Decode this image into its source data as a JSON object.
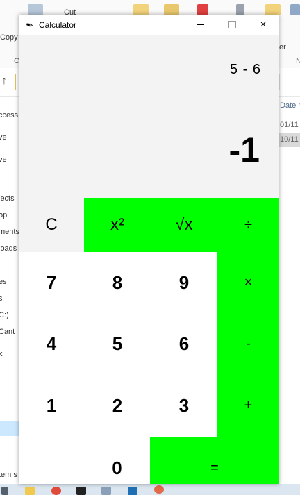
{
  "background_explorer": {
    "ribbon": {
      "copy_label": "Copy",
      "cut_label": "Cut",
      "clip_label": "C",
      "partial_label_right": "er",
      "n_label": "N"
    },
    "column_header_date": "Date m",
    "dates": [
      "01/11",
      "10/11"
    ],
    "nav_items": [
      "ccess",
      "ve",
      "ve",
      "jects",
      "op",
      "ments",
      "loads",
      "es",
      "s",
      "C:)",
      "Cant",
      "k",
      "tem s"
    ]
  },
  "calculator": {
    "title": "Calculator",
    "title_icon": "feather-icon",
    "window_controls": {
      "minimize": "minimize-icon",
      "maximize": "maximize-icon",
      "close": "×"
    },
    "display": {
      "expression": "5 - 6",
      "result": "-1"
    },
    "keys": {
      "clear": "C",
      "square": "x²",
      "sqrt": "√x",
      "divide": "÷",
      "seven": "7",
      "eight": "8",
      "nine": "9",
      "multiply": "×",
      "four": "4",
      "five": "5",
      "six": "6",
      "subtract": "-",
      "one": "1",
      "two": "2",
      "three": "3",
      "add": "+",
      "decimal": ".",
      "zero": "0",
      "equals": "="
    },
    "colors": {
      "accent": "#00ff00",
      "display_bg": "#f3f3f3",
      "key_bg": "#ffffff"
    }
  }
}
